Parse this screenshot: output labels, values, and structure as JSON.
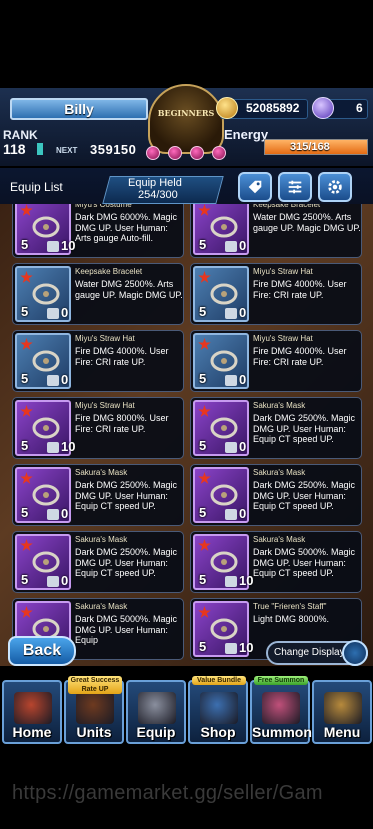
{
  "header": {
    "player_name": "Billy",
    "rank_label": "RANK",
    "rank_value": "118",
    "next_label": "NEXT",
    "next_value": "359150",
    "emblem_text": "BEGINNERS",
    "coins": "52085892",
    "gems": "6",
    "energy_label": "Energy",
    "energy_value": "315/168",
    "energy_fraction": 1.0
  },
  "list_bar": {
    "title": "Equip List",
    "held_label": "Equip Held",
    "held_value": "254/300",
    "buttons": [
      "tag-icon",
      "filter-icon",
      "gear-icon"
    ]
  },
  "cards": [
    {
      "name": "Miyu's Costume",
      "desc": "Dark DMG 6000%. Magic DMG UP. User Human: Arts gauge Auto-fill.",
      "rarity": "5",
      "level": "10",
      "frame": "purple"
    },
    {
      "name": "Keepsake Bracelet",
      "desc": "Water DMG 2500%. Arts gauge UP. Magic DMG UP.",
      "rarity": "5",
      "level": "0",
      "frame": "purple"
    },
    {
      "name": "Keepsake Bracelet",
      "desc": "Water DMG 2500%. Arts gauge UP. Magic DMG UP.",
      "rarity": "5",
      "level": "0",
      "frame": "blue"
    },
    {
      "name": "Miyu's Straw Hat",
      "desc": "Fire DMG 4000%. User Fire: CRI rate UP.",
      "rarity": "5",
      "level": "0",
      "frame": "blue"
    },
    {
      "name": "Miyu's Straw Hat",
      "desc": "Fire DMG 4000%. User Fire: CRI rate UP.",
      "rarity": "5",
      "level": "0",
      "frame": "blue"
    },
    {
      "name": "Miyu's Straw Hat",
      "desc": "Fire DMG 4000%. User Fire: CRI rate UP.",
      "rarity": "5",
      "level": "0",
      "frame": "blue"
    },
    {
      "name": "Miyu's Straw Hat",
      "desc": "Fire DMG 8000%. User Fire: CRI rate UP.",
      "rarity": "5",
      "level": "10",
      "frame": "purple"
    },
    {
      "name": "Sakura's Mask",
      "desc": "Dark DMG 2500%. Magic DMG UP. User Human: Equip CT speed UP.",
      "rarity": "5",
      "level": "0",
      "frame": "purple"
    },
    {
      "name": "Sakura's Mask",
      "desc": "Dark DMG 2500%. Magic DMG UP. User Human: Equip CT speed UP.",
      "rarity": "5",
      "level": "0",
      "frame": "purple"
    },
    {
      "name": "Sakura's Mask",
      "desc": "Dark DMG 2500%. Magic DMG UP. User Human: Equip CT speed UP.",
      "rarity": "5",
      "level": "0",
      "frame": "purple"
    },
    {
      "name": "Sakura's Mask",
      "desc": "Dark DMG 2500%. Magic DMG UP. User Human: Equip CT speed UP.",
      "rarity": "5",
      "level": "0",
      "frame": "purple"
    },
    {
      "name": "Sakura's Mask",
      "desc": "Dark DMG 5000%. Magic DMG UP. User Human: Equip CT speed UP.",
      "rarity": "5",
      "level": "10",
      "frame": "purple"
    },
    {
      "name": "Sakura's Mask",
      "desc": "Dark DMG 5000%. Magic DMG UP. User Human: Equip",
      "rarity": "5",
      "level": "10",
      "frame": "purple"
    },
    {
      "name": "True \"Frieren's Staff\"",
      "desc": "Light DMG 8000%.",
      "rarity": "5",
      "level": "10",
      "frame": "purple"
    }
  ],
  "buttons": {
    "back": "Back",
    "change_display": "Change Display"
  },
  "nav": [
    {
      "label": "Home",
      "tag": ""
    },
    {
      "label": "Units",
      "tag": "Great Success Rate UP"
    },
    {
      "label": "Equip",
      "tag": ""
    },
    {
      "label": "Shop",
      "tag": "Value Bundle"
    },
    {
      "label": "Summon",
      "tag": "Free Summon"
    },
    {
      "label": "Menu",
      "tag": ""
    }
  ],
  "watermark": "https://gamemarket.gg/seller/Gam",
  "colors": {
    "accent_blue": "#2d6fb0",
    "energy_orange": "#e46b13",
    "rarity_red": "#e7371f",
    "purple_frame": "#8a43c8"
  }
}
